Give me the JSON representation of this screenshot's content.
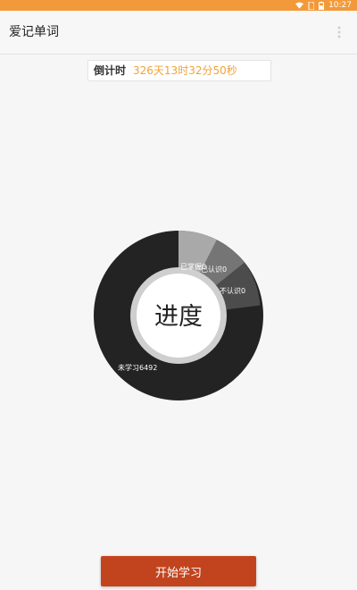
{
  "status_bar": {
    "time": "10:27"
  },
  "app_bar": {
    "title": "爱记单词"
  },
  "countdown": {
    "label": "倒计时",
    "value": "326天13时32分50秒"
  },
  "progress": {
    "center_label": "进度",
    "segments": [
      {
        "label": "已掌握0",
        "value": 0,
        "color": "#a9a9a9"
      },
      {
        "label": "已认识0",
        "value": 0,
        "color": "#757575"
      },
      {
        "label": "不认识0",
        "value": 0,
        "color": "#4c4c4c"
      },
      {
        "label": "未学习6492",
        "value": 6492,
        "color": "#232323"
      }
    ]
  },
  "actions": {
    "start_label": "开始学习"
  },
  "colors": {
    "status_bar": "#f29a3a",
    "accent_text": "#f2a23a",
    "button": "#c1441f"
  }
}
